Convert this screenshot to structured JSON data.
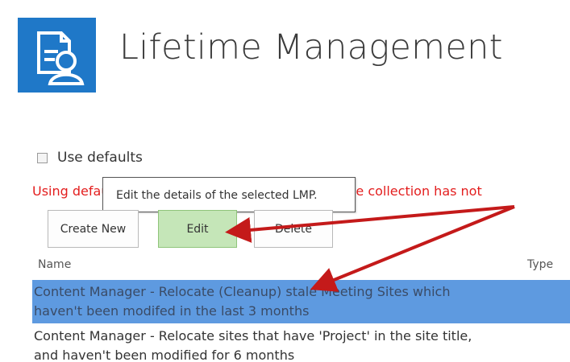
{
  "header": {
    "title": "Lifetime Management",
    "logo_icon": "document-user-icon"
  },
  "settings": {
    "use_defaults_label": "Use defaults",
    "use_defaults_checked": false,
    "warning_text": "Using default LMP settings because the default site collection has not"
  },
  "tooltip": {
    "text": "Edit the details of the selected LMP."
  },
  "toolbar": {
    "create_label": "Create New",
    "edit_label": "Edit",
    "delete_label": "Delete"
  },
  "table": {
    "columns": [
      "Name",
      "Type"
    ],
    "rows": [
      {
        "name": "Content Manager - Relocate (Cleanup) stale Meeting Sites which haven't been modifed in the last 3 months",
        "selected": true
      },
      {
        "name": "Content Manager - Relocate sites that have 'Project' in the site title, and haven't been modified for 6 months",
        "selected": false
      }
    ]
  },
  "colors": {
    "brand": "#1f78c8",
    "warning": "#e31e1e",
    "selected_row": "#5e9ae0",
    "edit_button": "#c5e6b8",
    "annotation_arrow": "#c41a1a"
  }
}
